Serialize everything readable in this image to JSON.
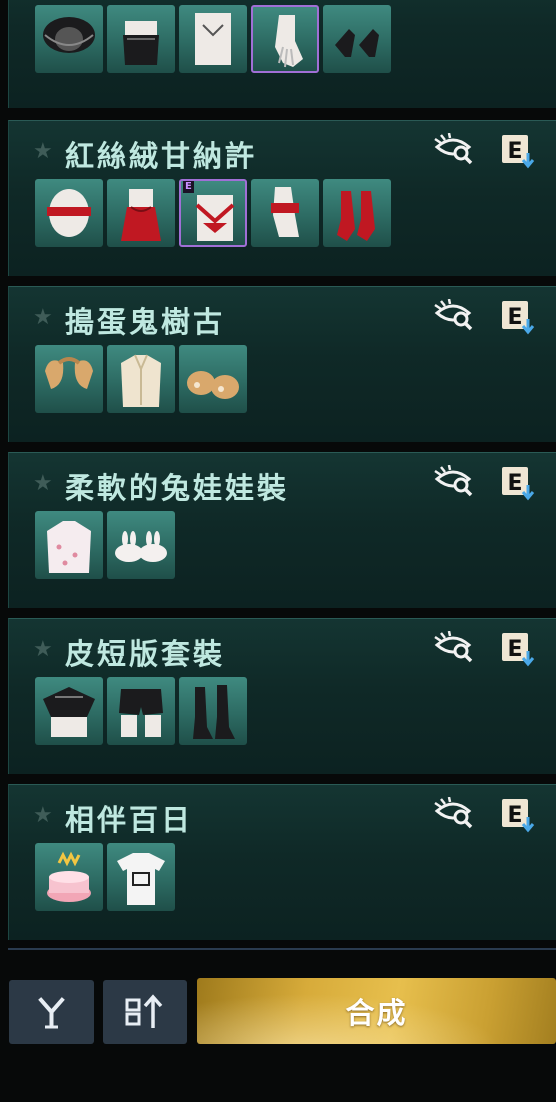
{
  "colors": {
    "title_text": "#bfe8e0",
    "panel_bg": "#0f2927",
    "item_bg": "#3f8a80",
    "selected_border": "#a06fd6",
    "craft_button": "#d7ab3a",
    "tool_button": "#2c3946"
  },
  "icons": {
    "favorite": "star-icon",
    "preview": "eye-search-icon",
    "equip": "equip-e-icon",
    "filter": "filter-y-icon",
    "sort": "sort-icon"
  },
  "sets": [
    {
      "title": "",
      "items": [
        {
          "name": "lace-veil-item",
          "selected": false
        },
        {
          "name": "black-lace-top-item",
          "selected": false
        },
        {
          "name": "white-bodysuit-item",
          "selected": false
        },
        {
          "name": "white-glove-item",
          "selected": true,
          "badge": ""
        },
        {
          "name": "black-heels-item",
          "selected": false
        }
      ]
    },
    {
      "title": "紅絲絨甘納許",
      "items": [
        {
          "name": "red-blindfold-item",
          "selected": false
        },
        {
          "name": "red-dress-item",
          "selected": false
        },
        {
          "name": "red-lingerie-item",
          "selected": true,
          "badge": "E"
        },
        {
          "name": "red-cuff-item",
          "selected": false
        },
        {
          "name": "red-boots-item",
          "selected": false
        }
      ]
    },
    {
      "title": "搗蛋鬼樹古",
      "items": [
        {
          "name": "puppy-ears-item",
          "selected": false
        },
        {
          "name": "cream-shirt-item",
          "selected": false
        },
        {
          "name": "paw-slippers-item",
          "selected": false
        }
      ]
    },
    {
      "title": "柔軟的兔娃娃裝",
      "items": [
        {
          "name": "bunny-hoodie-item",
          "selected": false
        },
        {
          "name": "bunny-slippers-item",
          "selected": false
        }
      ]
    },
    {
      "title": "皮短版套裝",
      "items": [
        {
          "name": "leather-crop-top-item",
          "selected": false
        },
        {
          "name": "leather-shorts-item",
          "selected": false
        },
        {
          "name": "leather-boots-item",
          "selected": false
        }
      ]
    },
    {
      "title": "相伴百日",
      "items": [
        {
          "name": "birthday-cake-item",
          "selected": false
        },
        {
          "name": "white-tshirt-item",
          "selected": false
        }
      ]
    }
  ],
  "bottom": {
    "craft_label": "合成"
  }
}
